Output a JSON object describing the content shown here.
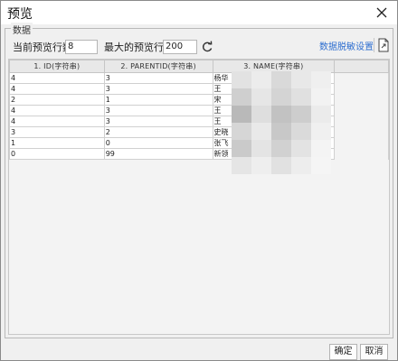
{
  "dialog": {
    "title": "预览"
  },
  "group": {
    "label": "数据"
  },
  "toolbar": {
    "current_rows_label": "当前预览行数:",
    "current_rows_value": "8",
    "max_rows_label": "最大的预览行数:",
    "max_rows_value": "200",
    "desensitize_link": "数据脱敏设置"
  },
  "table": {
    "columns": [
      "1. ID(字符串)",
      "2. PARENTID(字符串)",
      "3. NAME(字符串)"
    ],
    "rows": [
      [
        "4",
        "3",
        "杨华"
      ],
      [
        "4",
        "3",
        "王"
      ],
      [
        "2",
        "1",
        "宋"
      ],
      [
        "4",
        "3",
        "王"
      ],
      [
        "4",
        "3",
        "王"
      ],
      [
        "3",
        "2",
        "史晓"
      ],
      [
        "1",
        "0",
        "张飞"
      ],
      [
        "0",
        "99",
        "新领"
      ]
    ]
  },
  "footer": {
    "ok": "确定",
    "cancel": "取消"
  },
  "colors": {
    "link": "#2f6fd0",
    "header_bg": "#e8e8e8",
    "window_bg": "#f0f0f0"
  },
  "icons": [
    "close-icon",
    "refresh-icon",
    "export-icon"
  ]
}
